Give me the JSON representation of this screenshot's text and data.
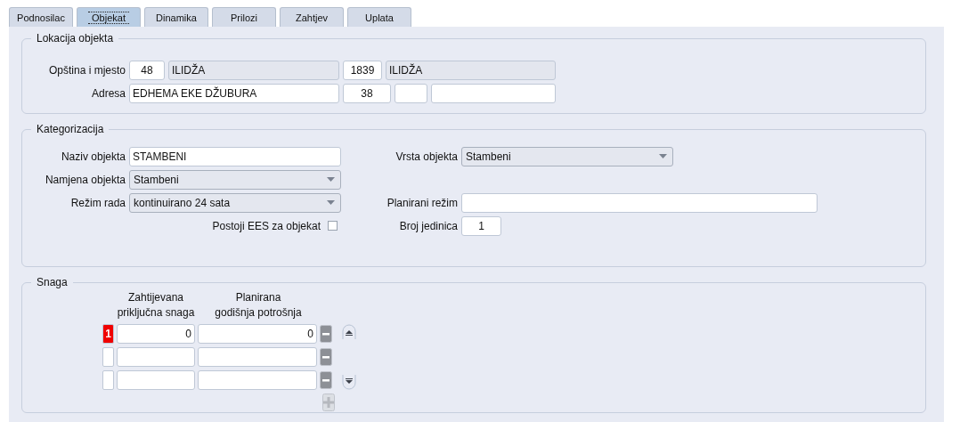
{
  "tabs": [
    {
      "label": "Podnosilac",
      "selected": false
    },
    {
      "label": "Objekat",
      "selected": true
    },
    {
      "label": "Dinamika",
      "selected": false
    },
    {
      "label": "Prilozi",
      "selected": false
    },
    {
      "label": "Zahtjev",
      "selected": false
    },
    {
      "label": "Uplata",
      "selected": false
    }
  ],
  "location": {
    "title": "Lokacija objekta",
    "municipality_label": "Opština i mjesto",
    "municipality_code": "48",
    "municipality_name": "ILIDŽA",
    "place_code": "1839",
    "place_name": "ILIDŽA",
    "address_label": "Adresa",
    "street": "EDHEMA EKE DŽUBURA",
    "house_number": "38"
  },
  "categorization": {
    "title": "Kategorizacija",
    "name_label": "Naziv objekta",
    "name_value": "STAMBENI",
    "purpose_label": "Namjena objekta",
    "purpose_value": "Stambeni",
    "mode_label": "Režim rada",
    "mode_value": "kontinuirano 24 sata",
    "ees_label": "Postoji EES za objekat",
    "ees_checked": false,
    "type_label": "Vrsta objekta",
    "type_value": "Stambeni",
    "planned_mode_label": "Planirani režim",
    "units_label": "Broj jedinica",
    "units_value": "1"
  },
  "power": {
    "title": "Snaga",
    "columns": [
      "Zahtijevana\npriključna snaga",
      "Planirana\ngodišnja potrošnja"
    ],
    "rows": [
      {
        "indicator": "1",
        "selected": true,
        "requested": "0",
        "planned": "0"
      },
      {
        "selected": false
      },
      {
        "selected": false
      }
    ]
  }
}
